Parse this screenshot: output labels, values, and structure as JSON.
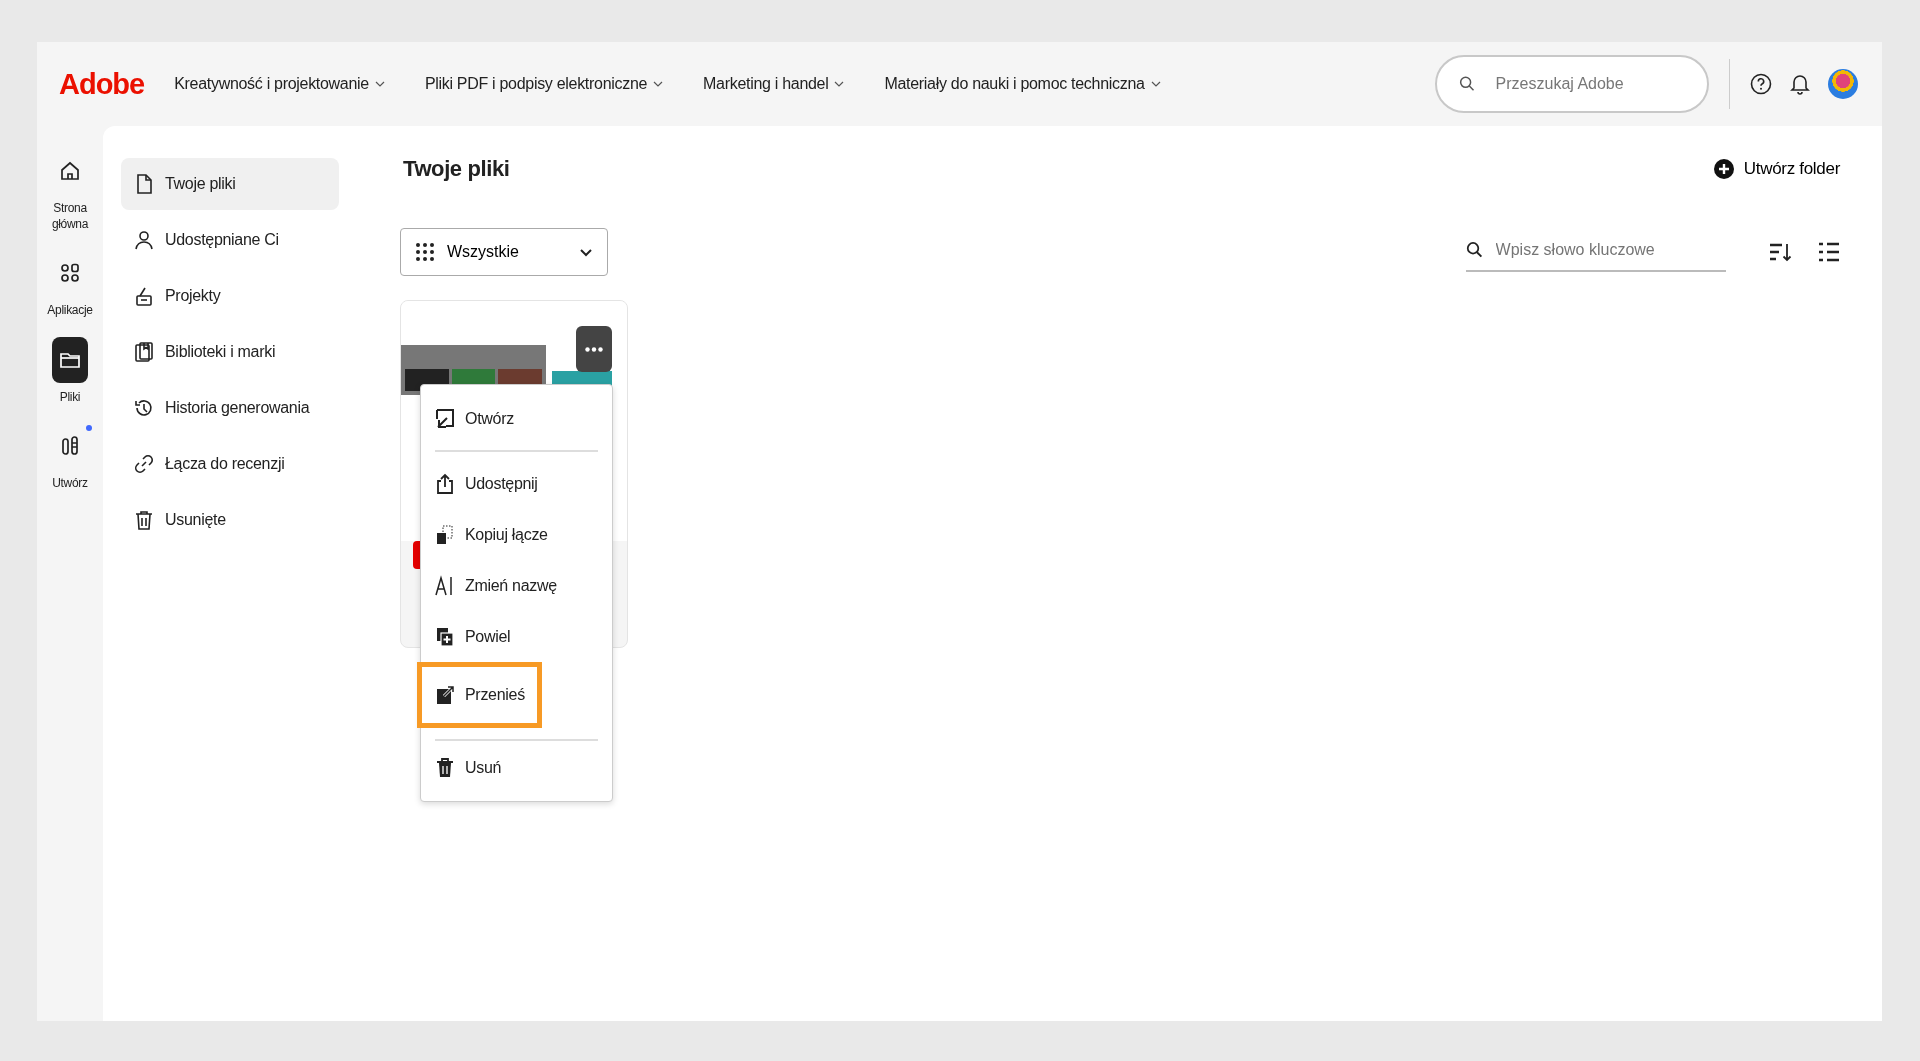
{
  "header": {
    "logo": "Adobe",
    "nav": [
      {
        "label": "Kreatywność i projektowanie"
      },
      {
        "label": "Pliki PDF i podpisy elektroniczne"
      },
      {
        "label": "Marketing i handel"
      },
      {
        "label": "Materiały do nauki i pomoc techniczna"
      }
    ],
    "search": {
      "placeholder": "Przeszukaj Adobe"
    }
  },
  "rail": [
    {
      "label": "Strona główna",
      "selected": false,
      "badge": false
    },
    {
      "label": "Aplikacje",
      "selected": false,
      "badge": false
    },
    {
      "label": "Pliki",
      "selected": true,
      "badge": false
    },
    {
      "label": "Utwórz",
      "selected": false,
      "badge": true
    }
  ],
  "sidebar": {
    "items": [
      {
        "label": "Twoje pliki",
        "selected": true
      },
      {
        "label": "Udostępniane Ci",
        "selected": false
      },
      {
        "label": "Projekty",
        "selected": false
      },
      {
        "label": "Biblioteki i marki",
        "selected": false
      },
      {
        "label": "Historia generowania",
        "selected": false
      },
      {
        "label": "Łącza do recenzji",
        "selected": false
      },
      {
        "label": "Usunięte",
        "selected": false
      }
    ]
  },
  "main": {
    "title": "Twoje pliki",
    "create_folder": "Utwórz folder",
    "filter": {
      "value": "Wszystkie"
    },
    "search": {
      "placeholder": "Wpisz słowo kluczowe"
    }
  },
  "context_menu": {
    "items": [
      {
        "label": "Otwórz",
        "divider_after": true,
        "highlighted": false
      },
      {
        "label": "Udostępnij",
        "divider_after": false,
        "highlighted": false
      },
      {
        "label": "Kopiuj łącze",
        "divider_after": false,
        "highlighted": false
      },
      {
        "label": "Zmień nazwę",
        "divider_after": false,
        "highlighted": false
      },
      {
        "label": "Powiel",
        "divider_after": false,
        "highlighted": false
      },
      {
        "label": "Przenieś",
        "divider_after": true,
        "highlighted": true
      },
      {
        "label": "Usuń",
        "divider_after": false,
        "highlighted": false
      }
    ]
  }
}
